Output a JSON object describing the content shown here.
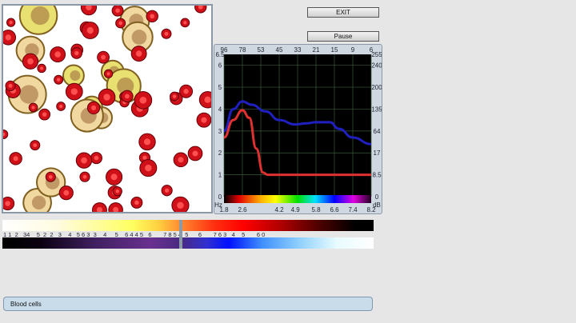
{
  "buttons": {
    "exit": "EXIT",
    "pause": "Pause"
  },
  "status_label": "Blood cells",
  "chart_data": {
    "type": "line",
    "x_unit": "Hz",
    "y2_unit": "dB",
    "top_ticks": [
      "96",
      "78",
      "53",
      "45",
      "33",
      "21",
      "15",
      "9",
      "6"
    ],
    "left_ticks": [
      "6.5",
      "6",
      "5",
      "4",
      "3",
      "2",
      "1",
      "0"
    ],
    "right_ticks": [
      "255",
      "240",
      "200",
      "135",
      "64",
      "17",
      "8.5",
      "0"
    ],
    "bottom_ticks": [
      "1.8",
      "2.6",
      "4.2",
      "4.9",
      "5.8",
      "6.6",
      "7.4",
      "8.2"
    ],
    "xlim": [
      1.8,
      8.2
    ],
    "ylim": [
      0,
      6.5
    ],
    "grid": true,
    "series": [
      {
        "color": "#2020c0",
        "x": [
          1.8,
          2.2,
          2.6,
          3.0,
          3.6,
          4.2,
          4.9,
          5.4,
          5.8,
          6.4,
          6.8,
          7.4,
          8.2
        ],
        "y": [
          3.0,
          4.0,
          4.35,
          4.2,
          3.9,
          3.5,
          3.3,
          3.35,
          3.4,
          3.4,
          3.1,
          2.7,
          2.4
        ]
      },
      {
        "color": "#e03030",
        "x": [
          1.8,
          2.2,
          2.6,
          2.9,
          3.2,
          3.5,
          3.7,
          8.2
        ],
        "y": [
          2.7,
          3.5,
          3.95,
          3.6,
          2.2,
          1.1,
          1.0,
          1.0
        ]
      }
    ]
  },
  "strip": {
    "top_labels": "1 1  2   34    5  2  2   3    4   5 6 3  3    4     5    6 4 4 5   6       7 8 5 4  5      6       7 6 3   4    5       6 0"
  }
}
